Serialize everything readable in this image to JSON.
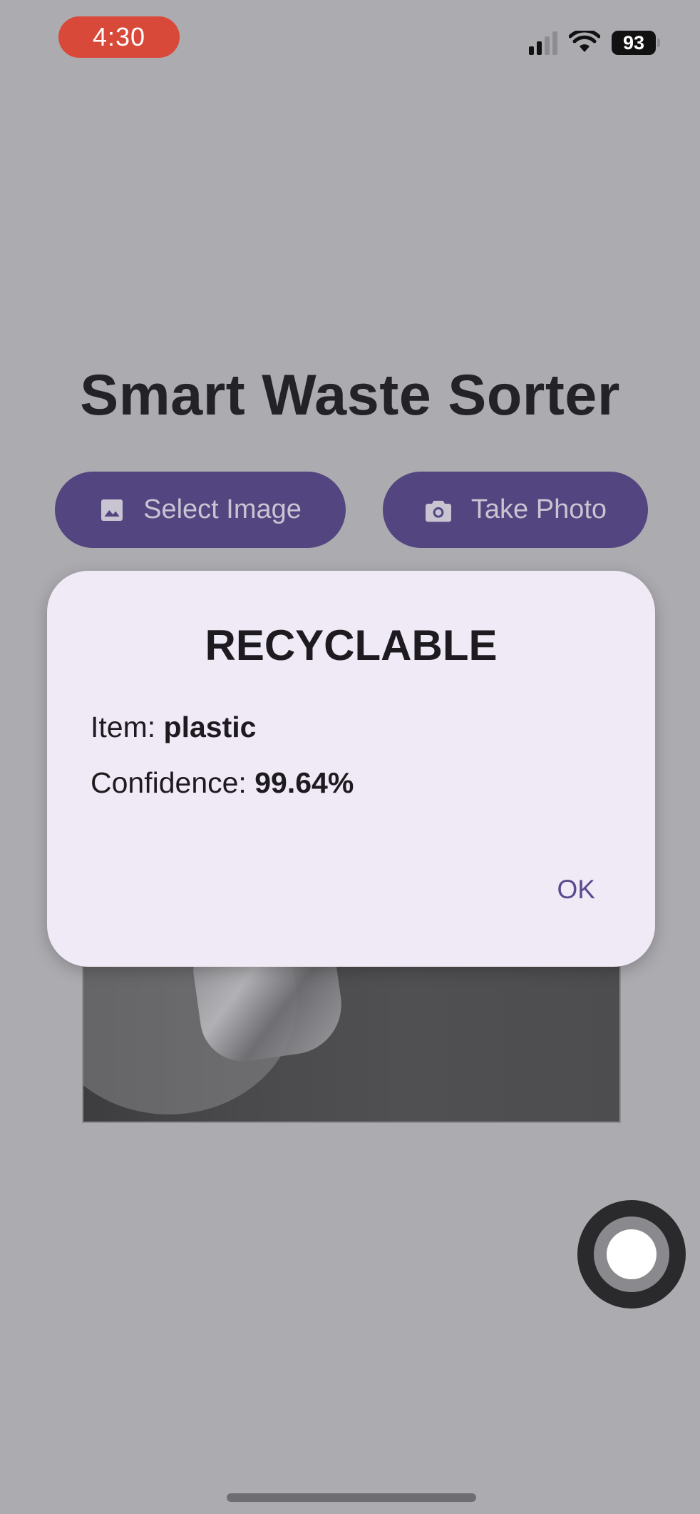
{
  "status_bar": {
    "time": "4:30",
    "battery": "93",
    "icons": [
      "cellular-signal-icon",
      "wifi-icon",
      "battery-icon"
    ]
  },
  "app": {
    "title": "Smart Waste Sorter"
  },
  "actions": {
    "select_image": {
      "label": "Select Image",
      "icon": "image-icon"
    },
    "take_photo": {
      "label": "Take Photo",
      "icon": "camera-icon"
    }
  },
  "dialog": {
    "title": "RECYCLABLE",
    "item_label": "Item: ",
    "item_value": "plastic",
    "confidence_label": "Confidence: ",
    "confidence_value": "99.64%",
    "ok_label": "OK"
  },
  "colors": {
    "background_dimmed": "#acabb0",
    "button": "#534580",
    "dialog": "#f0e9f6",
    "accent_text": "#5a4b8f",
    "recording_pill": "#d9493a"
  }
}
